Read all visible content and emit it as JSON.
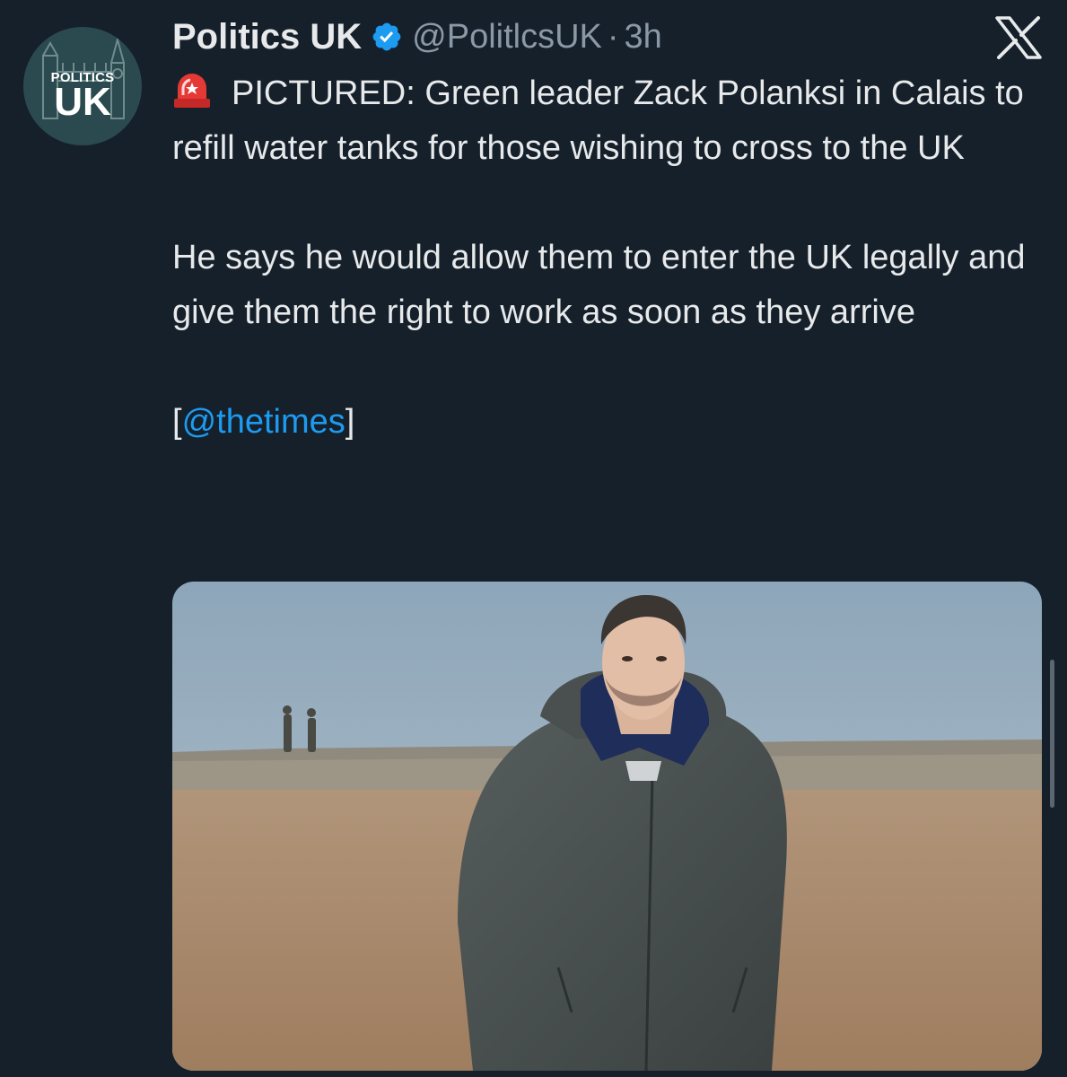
{
  "tweet": {
    "avatar": {
      "logo_small": "POLITICS",
      "logo_big": "UK"
    },
    "display_name": "Politics UK",
    "verified_icon": "verified-badge-icon",
    "handle": "@PolitlcsUK",
    "separator": "·",
    "time": "3h",
    "platform_icon": "x-logo-icon",
    "paragraphs": [
      {
        "icon": "police-siren-icon",
        "text": "PICTURED: Green leader Zack Polanksi in Calais to refill water tanks for those wishing to cross to the UK"
      },
      {
        "text": "He says he would allow them to enter the UK legally and give them the right to work as soon as they arrive"
      }
    ],
    "source": {
      "open": "[",
      "mention": "@thetimes",
      "close": "]"
    },
    "media": {
      "type": "photo"
    }
  },
  "colors": {
    "background": "#15202b",
    "text": "#e7e9ea",
    "secondary_text": "#8b98a5",
    "link": "#1d9bf0",
    "verified": "#1d9bf0"
  }
}
